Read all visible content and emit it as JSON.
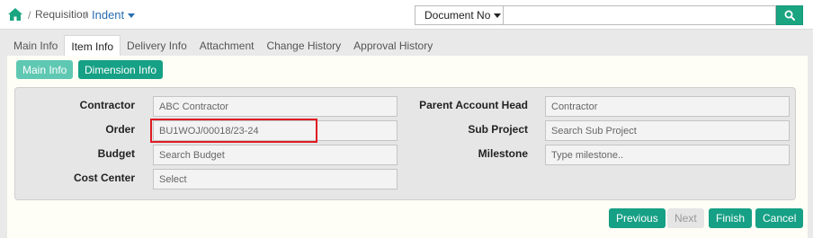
{
  "breadcrumb": {
    "separator": "/",
    "module": "Requisition",
    "current": "Indent"
  },
  "search": {
    "selected_filter": "Document No",
    "placeholder": ""
  },
  "tabs": [
    {
      "label": "Main Info",
      "active": false
    },
    {
      "label": "Item Info",
      "active": true
    },
    {
      "label": "Delivery Info",
      "active": false
    },
    {
      "label": "Attachment",
      "active": false
    },
    {
      "label": "Change History",
      "active": false
    },
    {
      "label": "Approval History",
      "active": false
    }
  ],
  "subtabs": {
    "main_info": "Main Info",
    "dimension_info": "Dimension Info"
  },
  "form": {
    "contractor": {
      "label": "Contractor",
      "value": "ABC Contractor"
    },
    "order": {
      "label": "Order",
      "value": "BU1WOJ/00018/23-24"
    },
    "budget": {
      "label": "Budget",
      "value": "Search Budget"
    },
    "cost_center": {
      "label": "Cost Center",
      "value": "Select"
    },
    "parent_account_head": {
      "label": "Parent Account Head",
      "value": "Contractor"
    },
    "sub_project": {
      "label": "Sub Project",
      "value": "Search Sub Project"
    },
    "milestone": {
      "label": "Milestone",
      "value": "Type milestone.."
    }
  },
  "buttons": {
    "previous": "Previous",
    "next": "Next",
    "finish": "Finish",
    "cancel": "Cancel"
  },
  "colors": {
    "accent": "#16a085",
    "accent_light": "#5fc8b2",
    "link": "#2a6db0",
    "highlight": "#e01b24"
  }
}
